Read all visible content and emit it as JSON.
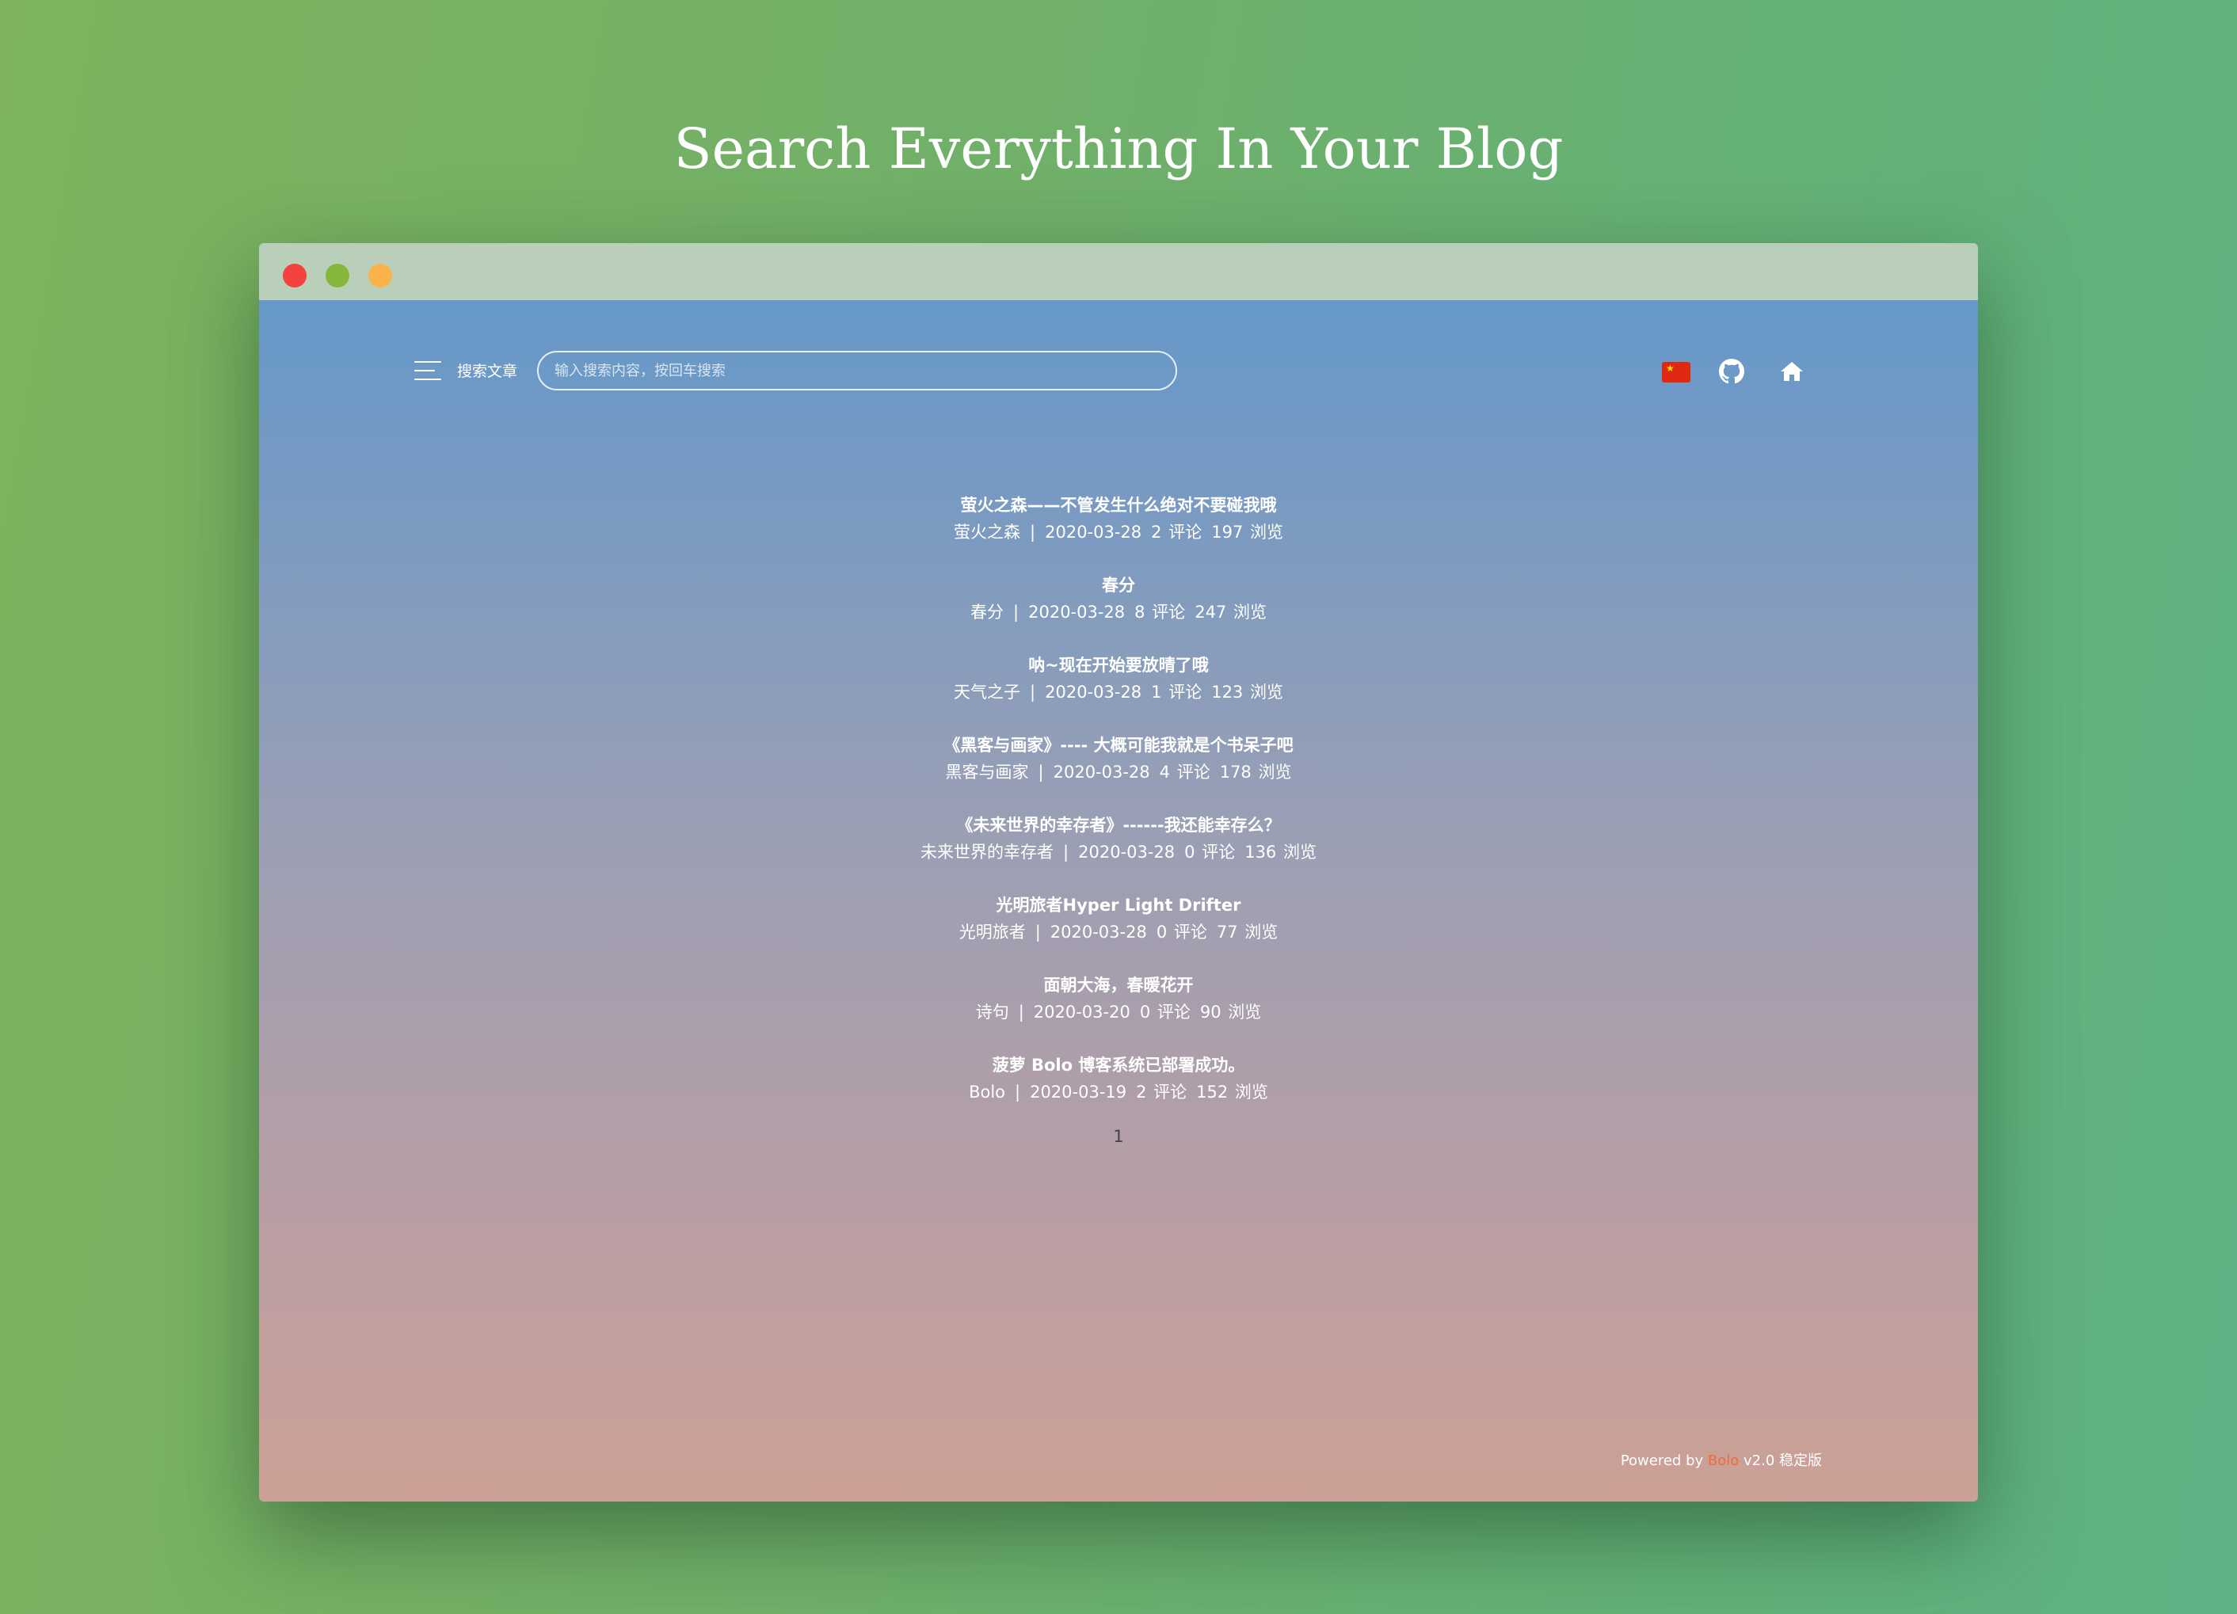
{
  "headline": "Search Everything In Your Blog",
  "nav": {
    "menu_label": "搜索文章",
    "search_placeholder": "输入搜索内容，按回车搜索",
    "icons": [
      "menu-icon",
      "china-flag-icon",
      "github-icon",
      "home-icon"
    ]
  },
  "posts": [
    {
      "title": "萤火之森——不管发生什么绝对不要碰我哦",
      "category": "萤火之森",
      "date": "2020-03-28",
      "comments": "2 评论",
      "views": "197 浏览"
    },
    {
      "title": "春分",
      "category": "春分",
      "date": "2020-03-28",
      "comments": "8 评论",
      "views": "247 浏览"
    },
    {
      "title": "呐~现在开始要放晴了哦",
      "category": "天气之子",
      "date": "2020-03-28",
      "comments": "1 评论",
      "views": "123 浏览"
    },
    {
      "title": "《黑客与画家》---- 大概可能我就是个书呆子吧",
      "category": "黑客与画家",
      "date": "2020-03-28",
      "comments": "4 评论",
      "views": "178 浏览"
    },
    {
      "title": "《未来世界的幸存者》------我还能幸存么？",
      "category": "未来世界的幸存者",
      "date": "2020-03-28",
      "comments": "0 评论",
      "views": "136 浏览"
    },
    {
      "title": "光明旅者Hyper Light Drifter",
      "category": "光明旅者",
      "date": "2020-03-28",
      "comments": "0 评论",
      "views": "77 浏览"
    },
    {
      "title": "面朝大海，春暖花开",
      "category": "诗句",
      "date": "2020-03-20",
      "comments": "0 评论",
      "views": "90 浏览"
    },
    {
      "title": "菠萝 Bolo 博客系统已部署成功。",
      "category": "Bolo",
      "date": "2020-03-19",
      "comments": "2 评论",
      "views": "152 浏览"
    }
  ],
  "meta_separator": "|",
  "pagination": {
    "current": "1"
  },
  "footer": {
    "powered_by": "Powered by",
    "brand": "Bolo",
    "version": "v2.0 稳定版"
  },
  "colors": {
    "window_dot_red": "#f3413d",
    "window_dot_green": "#86b73a",
    "window_dot_yellow": "#f9b348",
    "footer_brand": "#f06a3c"
  }
}
